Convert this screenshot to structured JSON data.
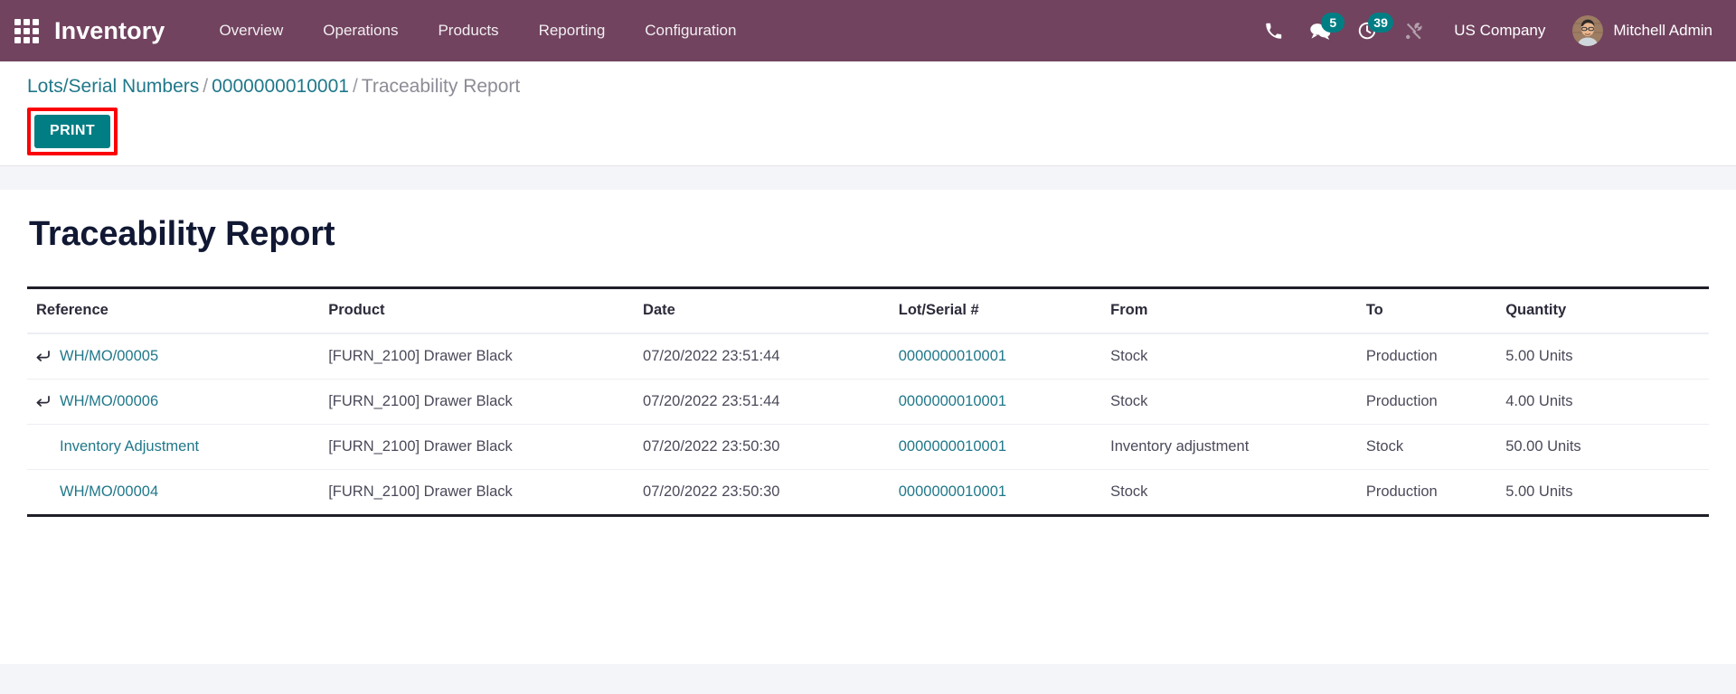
{
  "navbar": {
    "apps_icon": "apps-grid-icon",
    "brand": "Inventory",
    "menu": [
      {
        "label": "Overview"
      },
      {
        "label": "Operations"
      },
      {
        "label": "Products"
      },
      {
        "label": "Reporting"
      },
      {
        "label": "Configuration"
      }
    ],
    "systray": {
      "phone_icon": "phone-icon",
      "messages_icon": "messages-icon",
      "messages_count": "5",
      "activities_icon": "clock-activities-icon",
      "activities_count": "39",
      "debug_icon": "debug-tools-icon"
    },
    "company": "US Company",
    "user": "Mitchell Admin",
    "avatar_alt": "user-avatar"
  },
  "breadcrumb": {
    "root": "Lots/Serial Numbers",
    "separator": "/",
    "record": "0000000010001",
    "current": "Traceability Report"
  },
  "toolbar": {
    "print_label": "PRINT",
    "print_highlight_color": "#fb0007"
  },
  "report": {
    "title": "Traceability Report",
    "columns": [
      "Reference",
      "Product",
      "Date",
      "Lot/Serial #",
      "From",
      "To",
      "Quantity"
    ],
    "rows": [
      {
        "has_return_icon": true,
        "reference": "WH/MO/00005",
        "reference_is_link": true,
        "product": "[FURN_2100] Drawer Black",
        "date": "07/20/2022 23:51:44",
        "lot_serial": "0000000010001",
        "from": "Stock",
        "to": "Production",
        "quantity": "5.00 Units"
      },
      {
        "has_return_icon": true,
        "reference": "WH/MO/00006",
        "reference_is_link": true,
        "product": "[FURN_2100] Drawer Black",
        "date": "07/20/2022 23:51:44",
        "lot_serial": "0000000010001",
        "from": "Stock",
        "to": "Production",
        "quantity": "4.00 Units"
      },
      {
        "has_return_icon": false,
        "reference": "Inventory Adjustment",
        "reference_is_link": true,
        "product": "[FURN_2100] Drawer Black",
        "date": "07/20/2022 23:50:30",
        "lot_serial": "0000000010001",
        "from": "Inventory adjustment",
        "to": "Stock",
        "quantity": "50.00 Units"
      },
      {
        "has_return_icon": false,
        "reference": "WH/MO/00004",
        "reference_is_link": true,
        "product": "[FURN_2100] Drawer Black",
        "date": "07/20/2022 23:50:30",
        "lot_serial": "0000000010001",
        "from": "Stock",
        "to": "Production",
        "quantity": "5.00 Units"
      }
    ]
  },
  "colors": {
    "navbar_bg": "#71435f",
    "accent_teal": "#017e84",
    "link_teal": "#20788a",
    "page_bg": "#f4f5f9",
    "sheet_bg": "#ffffff"
  }
}
